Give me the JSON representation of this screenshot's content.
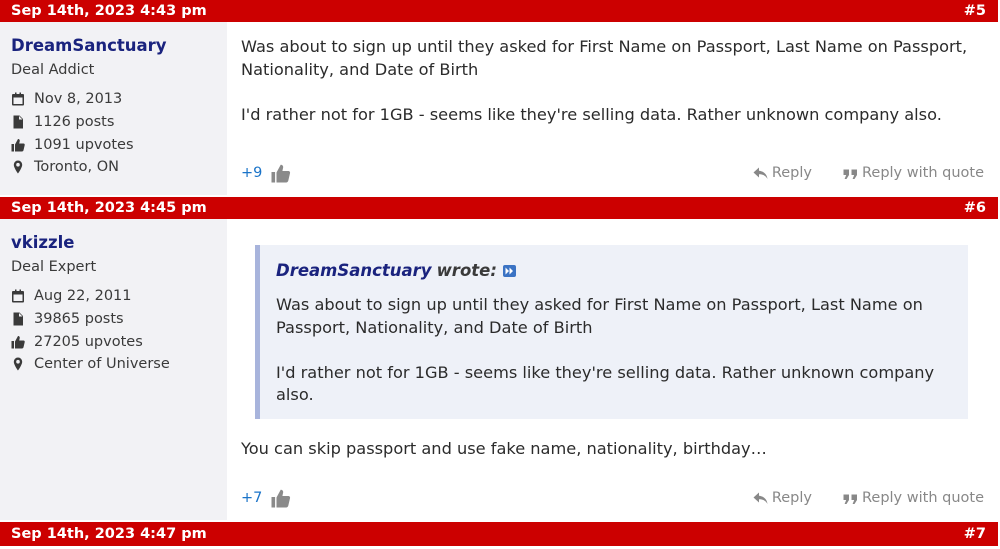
{
  "posts": [
    {
      "date": "Sep 14th, 2023 4:43 pm",
      "number": "#5",
      "user": {
        "name": "DreamSanctuary",
        "title": "Deal Addict",
        "joined": "Nov 8, 2013",
        "posts": "1126 posts",
        "upvotes": "1091 upvotes",
        "location": "Toronto, ON"
      },
      "body": [
        "Was about to sign up until they asked for First Name on Passport, Last Name on Passport, Nationality, and Date of Birth",
        "I'd rather not for 1GB - seems like they're selling data. Rather unknown company also."
      ],
      "votes": "+9",
      "reply_label": "Reply",
      "quote_label": "Reply with quote"
    },
    {
      "date": "Sep 14th, 2023 4:45 pm",
      "number": "#6",
      "user": {
        "name": "vkizzle",
        "title": "Deal Expert",
        "joined": "Aug 22, 2011",
        "posts": "39865 posts",
        "upvotes": "27205 upvotes",
        "location": "Center of Universe"
      },
      "quote": {
        "author": "DreamSanctuary",
        "wrote": "wrote:",
        "body": [
          "Was about to sign up until they asked for First Name on Passport, Last Name on Passport, Nationality, and Date of Birth",
          "I'd rather not for 1GB - seems like they're selling data. Rather unknown company also."
        ]
      },
      "body": [
        "You can skip passport and use fake name, nationality, birthday…"
      ],
      "votes": "+7",
      "reply_label": "Reply",
      "quote_label": "Reply with quote"
    },
    {
      "date": "Sep 14th, 2023 4:47 pm",
      "number": "#7"
    }
  ]
}
